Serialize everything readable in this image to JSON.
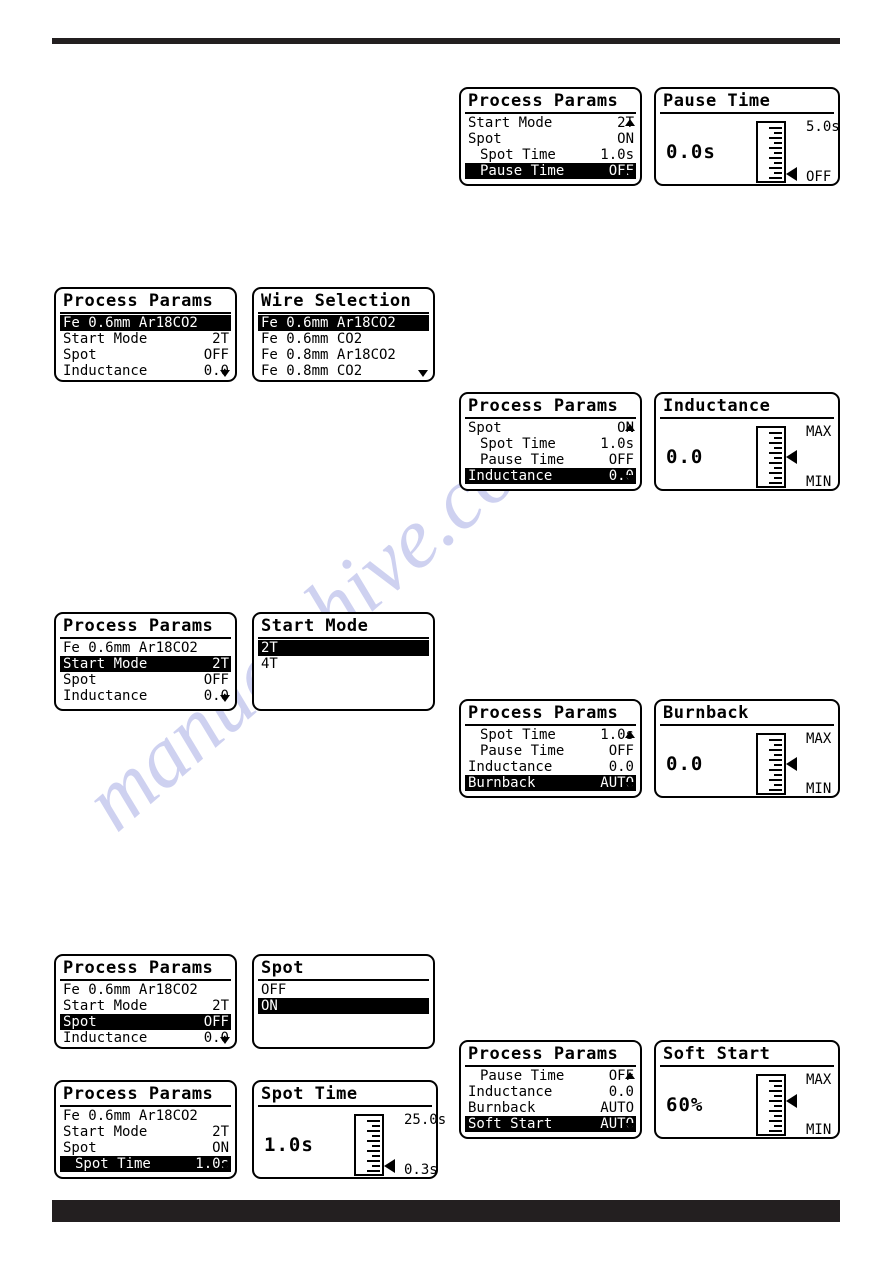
{
  "watermark": {
    "text": "manualshive.com"
  },
  "panels": {
    "pause_menu": {
      "title": "Process Params",
      "rows": [
        {
          "label": "Start Mode",
          "value": "2T",
          "indent": false,
          "selected": false
        },
        {
          "label": "Spot",
          "value": "ON",
          "indent": false,
          "selected": false
        },
        {
          "label": "Spot Time",
          "value": "1.0s",
          "indent": true,
          "selected": false
        },
        {
          "label": "Pause Time",
          "value": "OFF",
          "indent": true,
          "selected": true
        }
      ],
      "arrow_up": true,
      "arrow_down": true
    },
    "pause_gauge": {
      "title": "Pause Time",
      "value": "0.0s",
      "max_label": "5.0s",
      "min_label": "OFF",
      "pointer_pct": 4
    },
    "wire_menu": {
      "title": "Process Params",
      "rows": [
        {
          "label": "Fe 0.6mm Ar18CO2",
          "value": "",
          "indent": false,
          "selected": true
        },
        {
          "label": "Start Mode",
          "value": "2T",
          "indent": false,
          "selected": false
        },
        {
          "label": "Spot",
          "value": "OFF",
          "indent": false,
          "selected": false
        },
        {
          "label": "Inductance",
          "value": "0.0",
          "indent": false,
          "selected": false
        }
      ],
      "arrow_up": false,
      "arrow_down": true
    },
    "wire_list": {
      "title": "Wire Selection",
      "items": [
        {
          "label": "Fe 0.6mm Ar18CO2",
          "selected": true
        },
        {
          "label": "Fe 0.6mm CO2",
          "selected": false
        },
        {
          "label": "Fe 0.8mm Ar18CO2",
          "selected": false
        },
        {
          "label": "Fe 0.8mm CO2",
          "selected": false
        }
      ],
      "arrow_up": true,
      "arrow_down": true
    },
    "inductance_menu": {
      "title": "Process Params",
      "rows": [
        {
          "label": "Spot",
          "value": "ON",
          "indent": false,
          "selected": false
        },
        {
          "label": "Spot Time",
          "value": "1.0s",
          "indent": true,
          "selected": false
        },
        {
          "label": "Pause Time",
          "value": "OFF",
          "indent": true,
          "selected": false
        },
        {
          "label": "Inductance",
          "value": "0.0",
          "indent": false,
          "selected": true
        }
      ],
      "arrow_up": true,
      "arrow_down": true
    },
    "inductance_gauge": {
      "title": "Inductance",
      "value": "0.0",
      "max_label": "MAX",
      "min_label": "MIN",
      "pointer_pct": 50
    },
    "startmode_menu": {
      "title": "Process Params",
      "rows": [
        {
          "label": "Fe 0.6mm Ar18CO2",
          "value": "",
          "indent": false,
          "selected": false
        },
        {
          "label": "Start Mode",
          "value": "2T",
          "indent": false,
          "selected": true
        },
        {
          "label": "Spot",
          "value": "OFF",
          "indent": false,
          "selected": false
        },
        {
          "label": "Inductance",
          "value": "0.0",
          "indent": false,
          "selected": false
        }
      ],
      "arrow_up": false,
      "arrow_down": true
    },
    "startmode_list": {
      "title": "Start Mode",
      "items": [
        {
          "label": "2T",
          "selected": true
        },
        {
          "label": "4T",
          "selected": false
        }
      ],
      "arrow_up": false,
      "arrow_down": false
    },
    "burnback_menu": {
      "title": "Process Params",
      "rows": [
        {
          "label": "Spot Time",
          "value": "1.0s",
          "indent": true,
          "selected": false
        },
        {
          "label": "Pause Time",
          "value": "OFF",
          "indent": true,
          "selected": false
        },
        {
          "label": "Inductance",
          "value": "0.0",
          "indent": false,
          "selected": false
        },
        {
          "label": "Burnback",
          "value": "AUTO",
          "indent": false,
          "selected": true
        }
      ],
      "arrow_up": true,
      "arrow_down": true
    },
    "burnback_gauge": {
      "title": "Burnback",
      "value": "0.0",
      "max_label": "MAX",
      "min_label": "MIN",
      "pointer_pct": 50
    },
    "spot_menu": {
      "title": "Process Params",
      "rows": [
        {
          "label": "Fe 0.6mm Ar18CO2",
          "value": "",
          "indent": false,
          "selected": false
        },
        {
          "label": "Start Mode",
          "value": "2T",
          "indent": false,
          "selected": false
        },
        {
          "label": "Spot",
          "value": "OFF",
          "indent": false,
          "selected": true
        },
        {
          "label": "Inductance",
          "value": "0.0",
          "indent": false,
          "selected": false
        }
      ],
      "arrow_up": false,
      "arrow_down": true
    },
    "spot_list": {
      "title": "Spot",
      "items": [
        {
          "label": "OFF",
          "selected": false
        },
        {
          "label": "ON",
          "selected": true
        }
      ],
      "arrow_up": false,
      "arrow_down": false
    },
    "spottime_menu": {
      "title": "Process Params",
      "rows": [
        {
          "label": "Fe 0.6mm Ar18CO2",
          "value": "",
          "indent": false,
          "selected": false
        },
        {
          "label": "Start Mode",
          "value": "2T",
          "indent": false,
          "selected": false
        },
        {
          "label": "Spot",
          "value": "ON",
          "indent": false,
          "selected": false
        },
        {
          "label": "Spot Time",
          "value": "1.0s",
          "indent": true,
          "selected": true
        }
      ],
      "arrow_up": false,
      "arrow_down": true
    },
    "spottime_gauge": {
      "title": "Spot Time",
      "value": "1.0s",
      "max_label": "25.0s",
      "min_label": "0.3s",
      "pointer_pct": 6
    },
    "softstart_menu": {
      "title": "Process Params",
      "rows": [
        {
          "label": "Pause Time",
          "value": "OFF",
          "indent": true,
          "selected": false
        },
        {
          "label": "Inductance",
          "value": "0.0",
          "indent": false,
          "selected": false
        },
        {
          "label": "Burnback",
          "value": "AUTO",
          "indent": false,
          "selected": false
        },
        {
          "label": "Soft Start",
          "value": "AUTO",
          "indent": false,
          "selected": true
        }
      ],
      "arrow_up": true,
      "arrow_down": true
    },
    "softstart_gauge": {
      "title": "Soft Start",
      "value": "60%",
      "max_label": "MAX",
      "min_label": "MIN",
      "pointer_pct": 58
    }
  }
}
